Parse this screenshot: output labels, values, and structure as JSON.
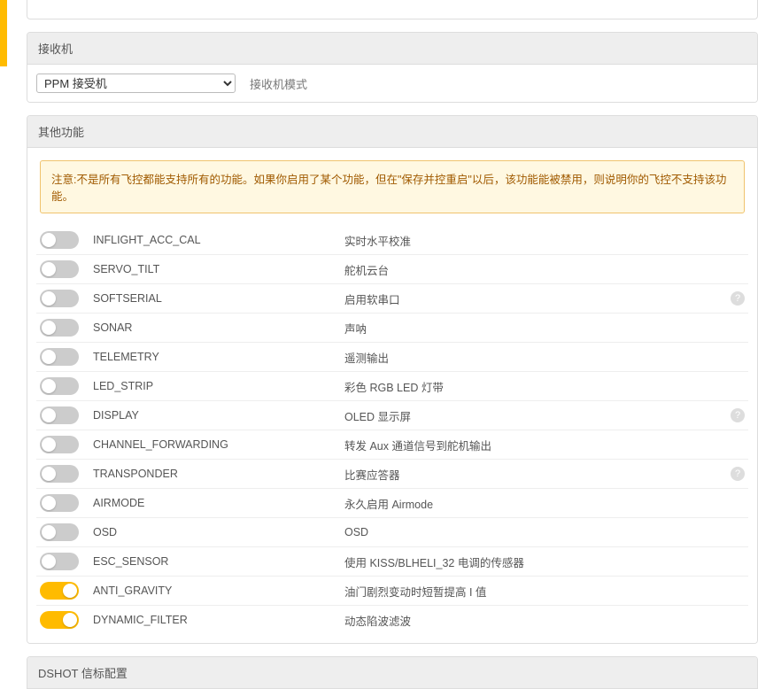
{
  "receiver": {
    "header": "接收机",
    "mode_value": "PPM 接受机",
    "mode_label": "接收机模式"
  },
  "other": {
    "header": "其他功能",
    "warning": "注意:不是所有飞控都能支持所有的功能。如果你启用了某个功能，但在\"保存并控重启\"以后，该功能能被禁用，则说明你的飞控不支持该功能。",
    "features": [
      {
        "name": "INFLIGHT_ACC_CAL",
        "desc": "实时水平校准",
        "on": false,
        "help": false
      },
      {
        "name": "SERVO_TILT",
        "desc": "舵机云台",
        "on": false,
        "help": false
      },
      {
        "name": "SOFTSERIAL",
        "desc": "启用软串口",
        "on": false,
        "help": true
      },
      {
        "name": "SONAR",
        "desc": "声呐",
        "on": false,
        "help": false
      },
      {
        "name": "TELEMETRY",
        "desc": "遥测输出",
        "on": false,
        "help": false
      },
      {
        "name": "LED_STRIP",
        "desc": "彩色 RGB LED 灯带",
        "on": false,
        "help": false
      },
      {
        "name": "DISPLAY",
        "desc": "OLED 显示屏",
        "on": false,
        "help": true
      },
      {
        "name": "CHANNEL_FORWARDING",
        "desc": "转发 Aux 通道信号到舵机输出",
        "on": false,
        "help": false
      },
      {
        "name": "TRANSPONDER",
        "desc": "比赛应答器",
        "on": false,
        "help": true
      },
      {
        "name": "AIRMODE",
        "desc": "永久启用 Airmode",
        "on": false,
        "help": false
      },
      {
        "name": "OSD",
        "desc": "OSD",
        "on": false,
        "help": false
      },
      {
        "name": "ESC_SENSOR",
        "desc": "使用 KISS/BLHELI_32 电调的传感器",
        "on": false,
        "help": false
      },
      {
        "name": "ANTI_GRAVITY",
        "desc": "油门剧烈变动时短暂提高 I 值",
        "on": true,
        "help": false
      },
      {
        "name": "DYNAMIC_FILTER",
        "desc": "动态陷波滤波",
        "on": true,
        "help": false
      }
    ]
  },
  "dshot": {
    "header": "DSHOT 信标配置"
  }
}
